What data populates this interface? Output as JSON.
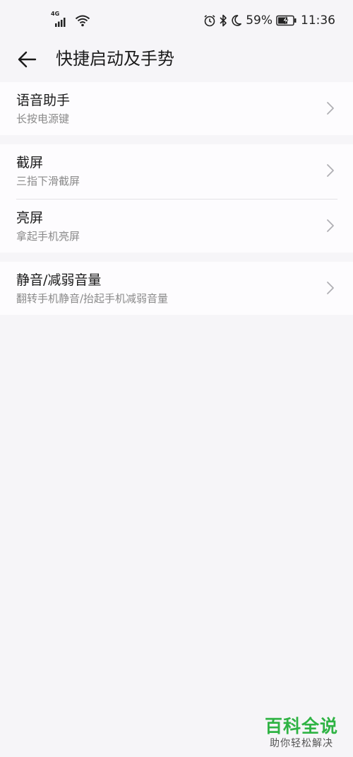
{
  "status_bar": {
    "network": "4G",
    "battery_percent": "59%",
    "time": "11:36",
    "icons": [
      "signal-icon",
      "wifi-icon",
      "alarm-icon",
      "bluetooth-icon",
      "moon-icon",
      "battery-charging-icon"
    ]
  },
  "header": {
    "back_icon": "arrow-left-icon",
    "title": "快捷启动及手势"
  },
  "groups": [
    {
      "items": [
        {
          "title": "语音助手",
          "subtitle": "长按电源键"
        }
      ]
    },
    {
      "items": [
        {
          "title": "截屏",
          "subtitle": "三指下滑截屏"
        },
        {
          "title": "亮屏",
          "subtitle": "拿起手机亮屏"
        }
      ]
    },
    {
      "items": [
        {
          "title": "静音/减弱音量",
          "subtitle": "翻转手机静音/抬起手机减弱音量"
        }
      ]
    }
  ],
  "watermark": {
    "title": "百科全说",
    "subtitle": "助你轻松解决"
  },
  "colors": {
    "background": "#f6f5f8",
    "card": "#fdfcfe",
    "watermark_green": "#2fb344"
  }
}
